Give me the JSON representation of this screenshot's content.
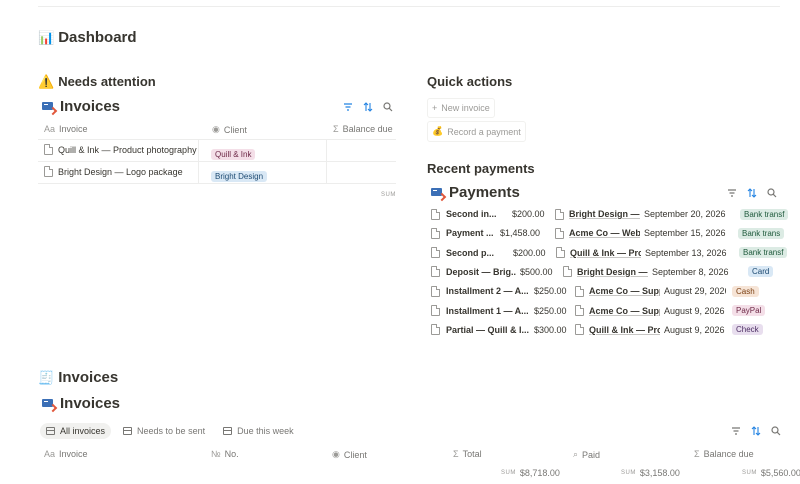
{
  "page": {
    "title": "Dashboard",
    "title_emoji": "📊"
  },
  "needs_attention": {
    "heading": "Needs attention",
    "emoji": "⚠️",
    "db_title": "Invoices",
    "columns": [
      {
        "icon": "Aa",
        "label": "Invoice"
      },
      {
        "icon": "◉",
        "label": "Client"
      },
      {
        "icon": "Σ",
        "label": "Balance due"
      }
    ],
    "rows": [
      {
        "name": "Quill & Ink — Product photography",
        "client": "Quill & Ink"
      },
      {
        "name": "Bright Design — Logo package",
        "client": "Bright Design"
      }
    ],
    "sum_label": "SUM"
  },
  "quick_actions": {
    "heading": "Quick actions",
    "new_invoice": "New invoice",
    "record_payment": "Record a payment"
  },
  "recent_payments": {
    "heading": "Recent payments",
    "db_title": "Payments",
    "rows": [
      {
        "name": "Second in...",
        "amount": "$200.00",
        "invoice": "Bright Design — B",
        "date": "September 20, 2026",
        "method": "Bank transf"
      },
      {
        "name": "Payment ...",
        "amount": "$1,458.00",
        "invoice": "Acme Co — Websi",
        "date": "September 15, 2026",
        "method": "Bank trans"
      },
      {
        "name": "Second p...",
        "amount": "$200.00",
        "invoice": "Quill & Ink — Prod",
        "date": "September 13, 2026",
        "method": "Bank transf"
      },
      {
        "name": "Deposit — Brig...",
        "amount": "$500.00",
        "invoice": "Bright Design — B",
        "date": "September 8, 2026",
        "method": "Card"
      },
      {
        "name": "Installment 2 — A...",
        "amount": "$250.00",
        "invoice": "Acme Co — Suppo",
        "date": "August 29, 2026",
        "method": "Cash"
      },
      {
        "name": "Installment 1 — A...",
        "amount": "$250.00",
        "invoice": "Acme Co — Suppo",
        "date": "August 9, 2026",
        "method": "PayPal"
      },
      {
        "name": "Partial — Quill & I...",
        "amount": "$300.00",
        "invoice": "Quill & Ink — Prod",
        "date": "August 9, 2026",
        "method": "Check"
      }
    ]
  },
  "invoices_section": {
    "heading": "Invoices",
    "emoji": "🧾",
    "db_title": "Invoices",
    "tabs": [
      "All invoices",
      "Needs to be sent",
      "Due this week"
    ],
    "columns": [
      {
        "icon": "Aa",
        "label": "Invoice"
      },
      {
        "icon": "№",
        "label": "No."
      },
      {
        "icon": "◉",
        "label": "Client"
      },
      {
        "icon": "Σ",
        "label": "Total"
      },
      {
        "icon": "🔍",
        "label": "Paid"
      },
      {
        "icon": "Σ",
        "label": "Balance due"
      }
    ],
    "sums": {
      "label": "SUM",
      "total": "$8,718.00",
      "paid": "$3,158.00",
      "balance": "$5,560.00"
    }
  },
  "colors": {
    "tag_pink": "#f4dfe8",
    "tag_blue": "#d9e8f5",
    "tag_green": "#dcebe4",
    "tag_orange": "#f6e4d6",
    "tag_purple": "#e8deee",
    "tag_gray": "#e3e2e0",
    "accent_blue": "#2383e2"
  }
}
